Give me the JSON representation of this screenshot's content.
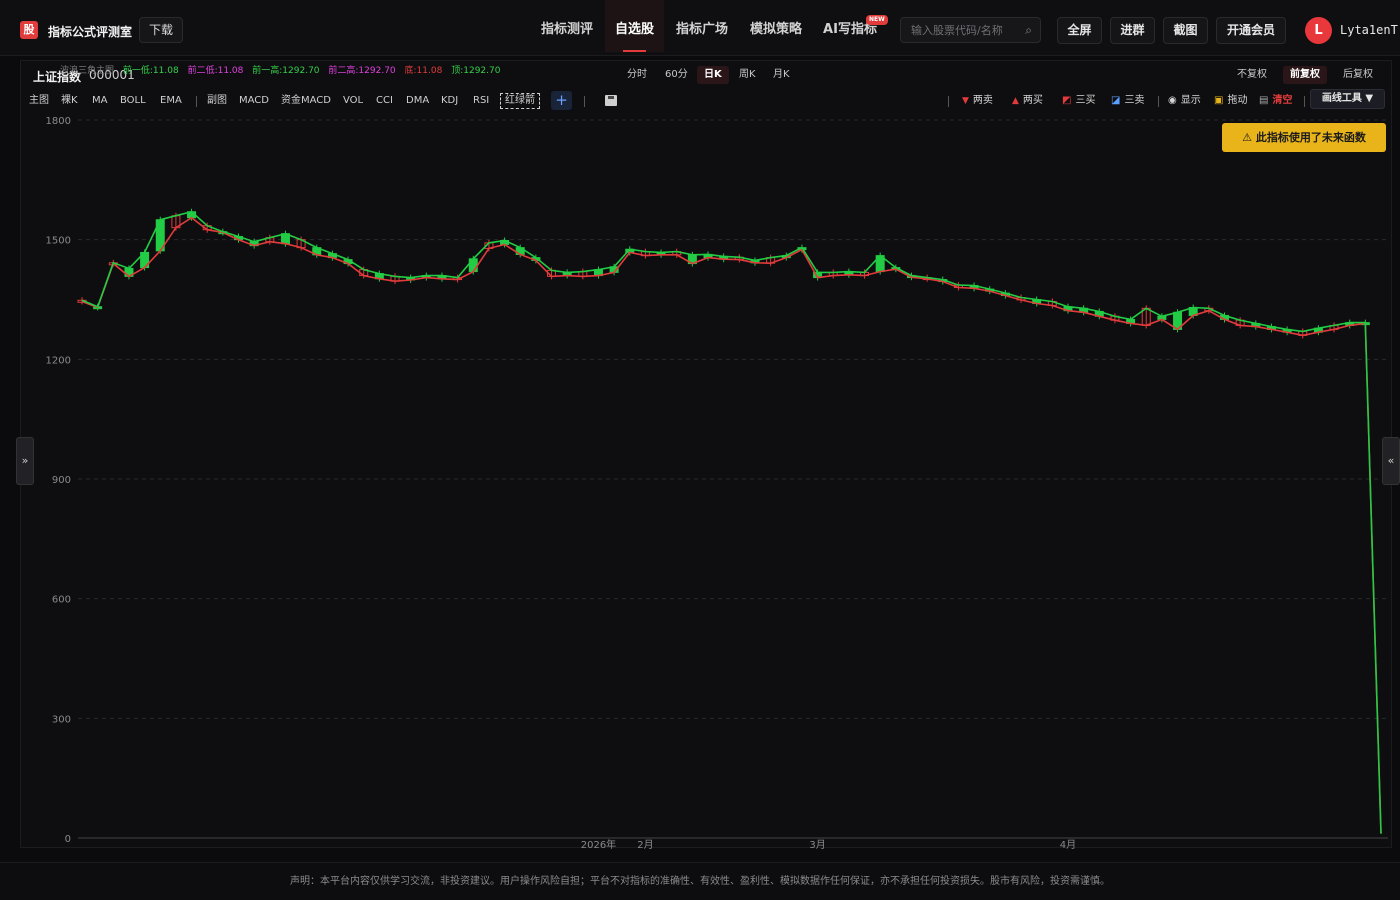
{
  "app": {
    "logo_char": "股",
    "title": "指标公式评测室",
    "download_label": "下载"
  },
  "nav": {
    "items": [
      {
        "label": "指标测评",
        "active": false
      },
      {
        "label": "自选股",
        "active": true
      },
      {
        "label": "指标广场",
        "active": false
      },
      {
        "label": "模拟策略",
        "active": false
      },
      {
        "label": "AI写指标",
        "active": false
      }
    ],
    "new_badge": "NEW"
  },
  "search": {
    "placeholder": "输入股票代码/名称"
  },
  "top_buttons": [
    "全屏",
    "进群",
    "截图",
    "开通会员"
  ],
  "user": {
    "avatar_letter": "L",
    "name": "Lyta1enT"
  },
  "stock": {
    "name": "上证指数",
    "code": "000001"
  },
  "periods": [
    {
      "label": "分时",
      "active": false
    },
    {
      "label": "60分",
      "active": false
    },
    {
      "label": "日K",
      "active": true
    },
    {
      "label": "周K",
      "active": false
    },
    {
      "label": "月K",
      "active": false
    }
  ],
  "adjust": [
    {
      "label": "不复权",
      "active": false
    },
    {
      "label": "前复权",
      "active": true
    },
    {
      "label": "后复权",
      "active": false
    }
  ],
  "indicators_main": [
    "主图",
    "裸K",
    "MA",
    "BOLL",
    "EMA"
  ],
  "indicators_sub": [
    "副图",
    "MACD",
    "资金MACD",
    "VOL",
    "CCI",
    "DMA",
    "KDJ",
    "RSI",
    "红绿箭"
  ],
  "tools": {
    "sell2": "两卖",
    "buy2": "两买",
    "buy3": "三买",
    "sell3": "三卖",
    "show": "显示",
    "drag": "拖动",
    "clear": "清空",
    "draw": "画线工具 ▼"
  },
  "warning": "此指标使用了未来函数",
  "legend": {
    "name": "波浪三角主图",
    "items": [
      {
        "text": "前一低:11.08",
        "color": "#35d04a"
      },
      {
        "text": "前二低:11.08",
        "color": "#e040e0"
      },
      {
        "text": "前一高:1292.70",
        "color": "#35d04a"
      },
      {
        "text": "前二高:1292.70",
        "color": "#e040e0"
      },
      {
        "text": "底:11.08",
        "color": "#e23b3b"
      },
      {
        "text": "顶:1292.70",
        "color": "#35d04a"
      }
    ]
  },
  "footer": "声明：本平台内容仅供学习交流，非投资建议。用户操作风险自担；平台不对指标的准确性、有效性、盈利性、模拟数据作任何保证，亦不承担任何投资损失。股市有风险，投资需谨慎。",
  "chart_data": {
    "type": "line",
    "title": "",
    "xlabel": "",
    "ylabel": "",
    "ylim": [
      0,
      1800
    ],
    "y_ticks": [
      0,
      300,
      600,
      900,
      1200,
      1500,
      1800
    ],
    "x_tick_labels": [
      "2026年",
      "2月",
      "3月",
      "4月"
    ],
    "x_tick_index": [
      33,
      36,
      47,
      63
    ],
    "grid": true,
    "up_color": "#e23b3b",
    "down_color": "#22cc44",
    "series": [
      {
        "values": [
          1345,
          1330,
          1440,
          1408,
          1430,
          1472,
          1530,
          1555,
          1525,
          1518,
          1500,
          1485,
          1495,
          1490,
          1480,
          1462,
          1455,
          1440,
          1410,
          1402,
          1396,
          1399,
          1405,
          1402,
          1400,
          1420,
          1478,
          1488,
          1463,
          1448,
          1408,
          1410,
          1408,
          1410,
          1418,
          1468,
          1460,
          1462,
          1462,
          1440,
          1455,
          1451,
          1450,
          1442,
          1441,
          1455,
          1475,
          1405,
          1410,
          1412,
          1410,
          1420,
          1426,
          1406,
          1402,
          1395,
          1380,
          1378,
          1371,
          1360,
          1349,
          1340,
          1335,
          1322,
          1318,
          1308,
          1298,
          1290,
          1285,
          1300,
          1275,
          1310,
          1322,
          1300,
          1285,
          1282,
          1275,
          1268,
          1260,
          1268,
          1275,
          1285,
          1290,
          11.08
        ]
      },
      {
        "values": [
          1348,
          1332,
          1442,
          1428,
          1468,
          1550,
          1560,
          1570,
          1535,
          1520,
          1508,
          1495,
          1505,
          1515,
          1500,
          1480,
          1465,
          1450,
          1425,
          1415,
          1408,
          1405,
          1410,
          1410,
          1405,
          1452,
          1492,
          1498,
          1480,
          1455,
          1423,
          1418,
          1420,
          1425,
          1432,
          1476,
          1470,
          1468,
          1470,
          1462,
          1463,
          1458,
          1456,
          1448,
          1455,
          1460,
          1480,
          1418,
          1418,
          1420,
          1418,
          1460,
          1430,
          1410,
          1405,
          1400,
          1386,
          1385,
          1376,
          1366,
          1355,
          1350,
          1345,
          1332,
          1328,
          1320,
          1308,
          1300,
          1328,
          1308,
          1318,
          1330,
          1328,
          1310,
          1298,
          1290,
          1282,
          1275,
          1270,
          1278,
          1285,
          1292,
          1292,
          11.08
        ]
      }
    ]
  }
}
